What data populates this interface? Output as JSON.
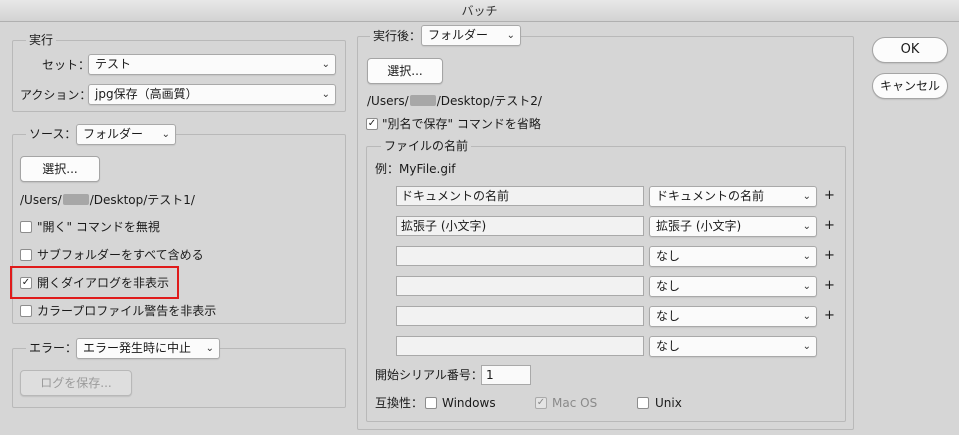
{
  "window": {
    "title": "バッチ"
  },
  "run": {
    "legend": "実行",
    "set_label": "セット：",
    "set_value": "テスト",
    "action_label": "アクション：",
    "action_value": "jpg保存（高画質）"
  },
  "source": {
    "label": "ソース：",
    "value": "フォルダー",
    "choose_button": "選択...",
    "path_prefix": "/Users/",
    "path_suffix": "/Desktop/テスト1/",
    "options": [
      {
        "label": "\"開く\" コマンドを無視",
        "checked": false
      },
      {
        "label": "サブフォルダーをすべて含める",
        "checked": false
      },
      {
        "label": "開くダイアログを非表示",
        "checked": true
      },
      {
        "label": "カラープロファイル警告を非表示",
        "checked": false
      }
    ]
  },
  "error": {
    "label": "エラー：",
    "value": "エラー発生時に中止",
    "save_log_button": "ログを保存..."
  },
  "destination": {
    "label": "実行後：",
    "value": "フォルダー",
    "choose_button": "選択...",
    "path_prefix": "/Users/",
    "path_suffix": "/Desktop/テスト2/",
    "override_label": "\"別名で保存\" コマンドを省略",
    "override_checked": true
  },
  "naming": {
    "legend": "ファイルの名前",
    "example": "例：MyFile.gif",
    "rows": [
      {
        "text": "ドキュメントの名前",
        "select": "ドキュメントの名前",
        "plus": "+"
      },
      {
        "text": "拡張子 (小文字)",
        "select": "拡張子 (小文字)",
        "plus": "+"
      },
      {
        "text": "",
        "select": "なし",
        "plus": "+"
      },
      {
        "text": "",
        "select": "なし",
        "plus": "+"
      },
      {
        "text": "",
        "select": "なし",
        "plus": "+"
      },
      {
        "text": "",
        "select": "なし",
        "plus": ""
      }
    ],
    "serial_label": "開始シリアル番号：",
    "serial_value": "1",
    "compat_label": "互換性：",
    "compat": [
      {
        "label": "Windows",
        "checked": false,
        "disabled": false
      },
      {
        "label": "Mac OS",
        "checked": true,
        "disabled": true
      },
      {
        "label": "Unix",
        "checked": false,
        "disabled": false
      }
    ]
  },
  "buttons": {
    "ok": "OK",
    "cancel": "キャンセル"
  },
  "icons": {
    "select_arrow": "⌄",
    "check": "✓"
  },
  "colors": {
    "highlight": "#e01b1b"
  }
}
